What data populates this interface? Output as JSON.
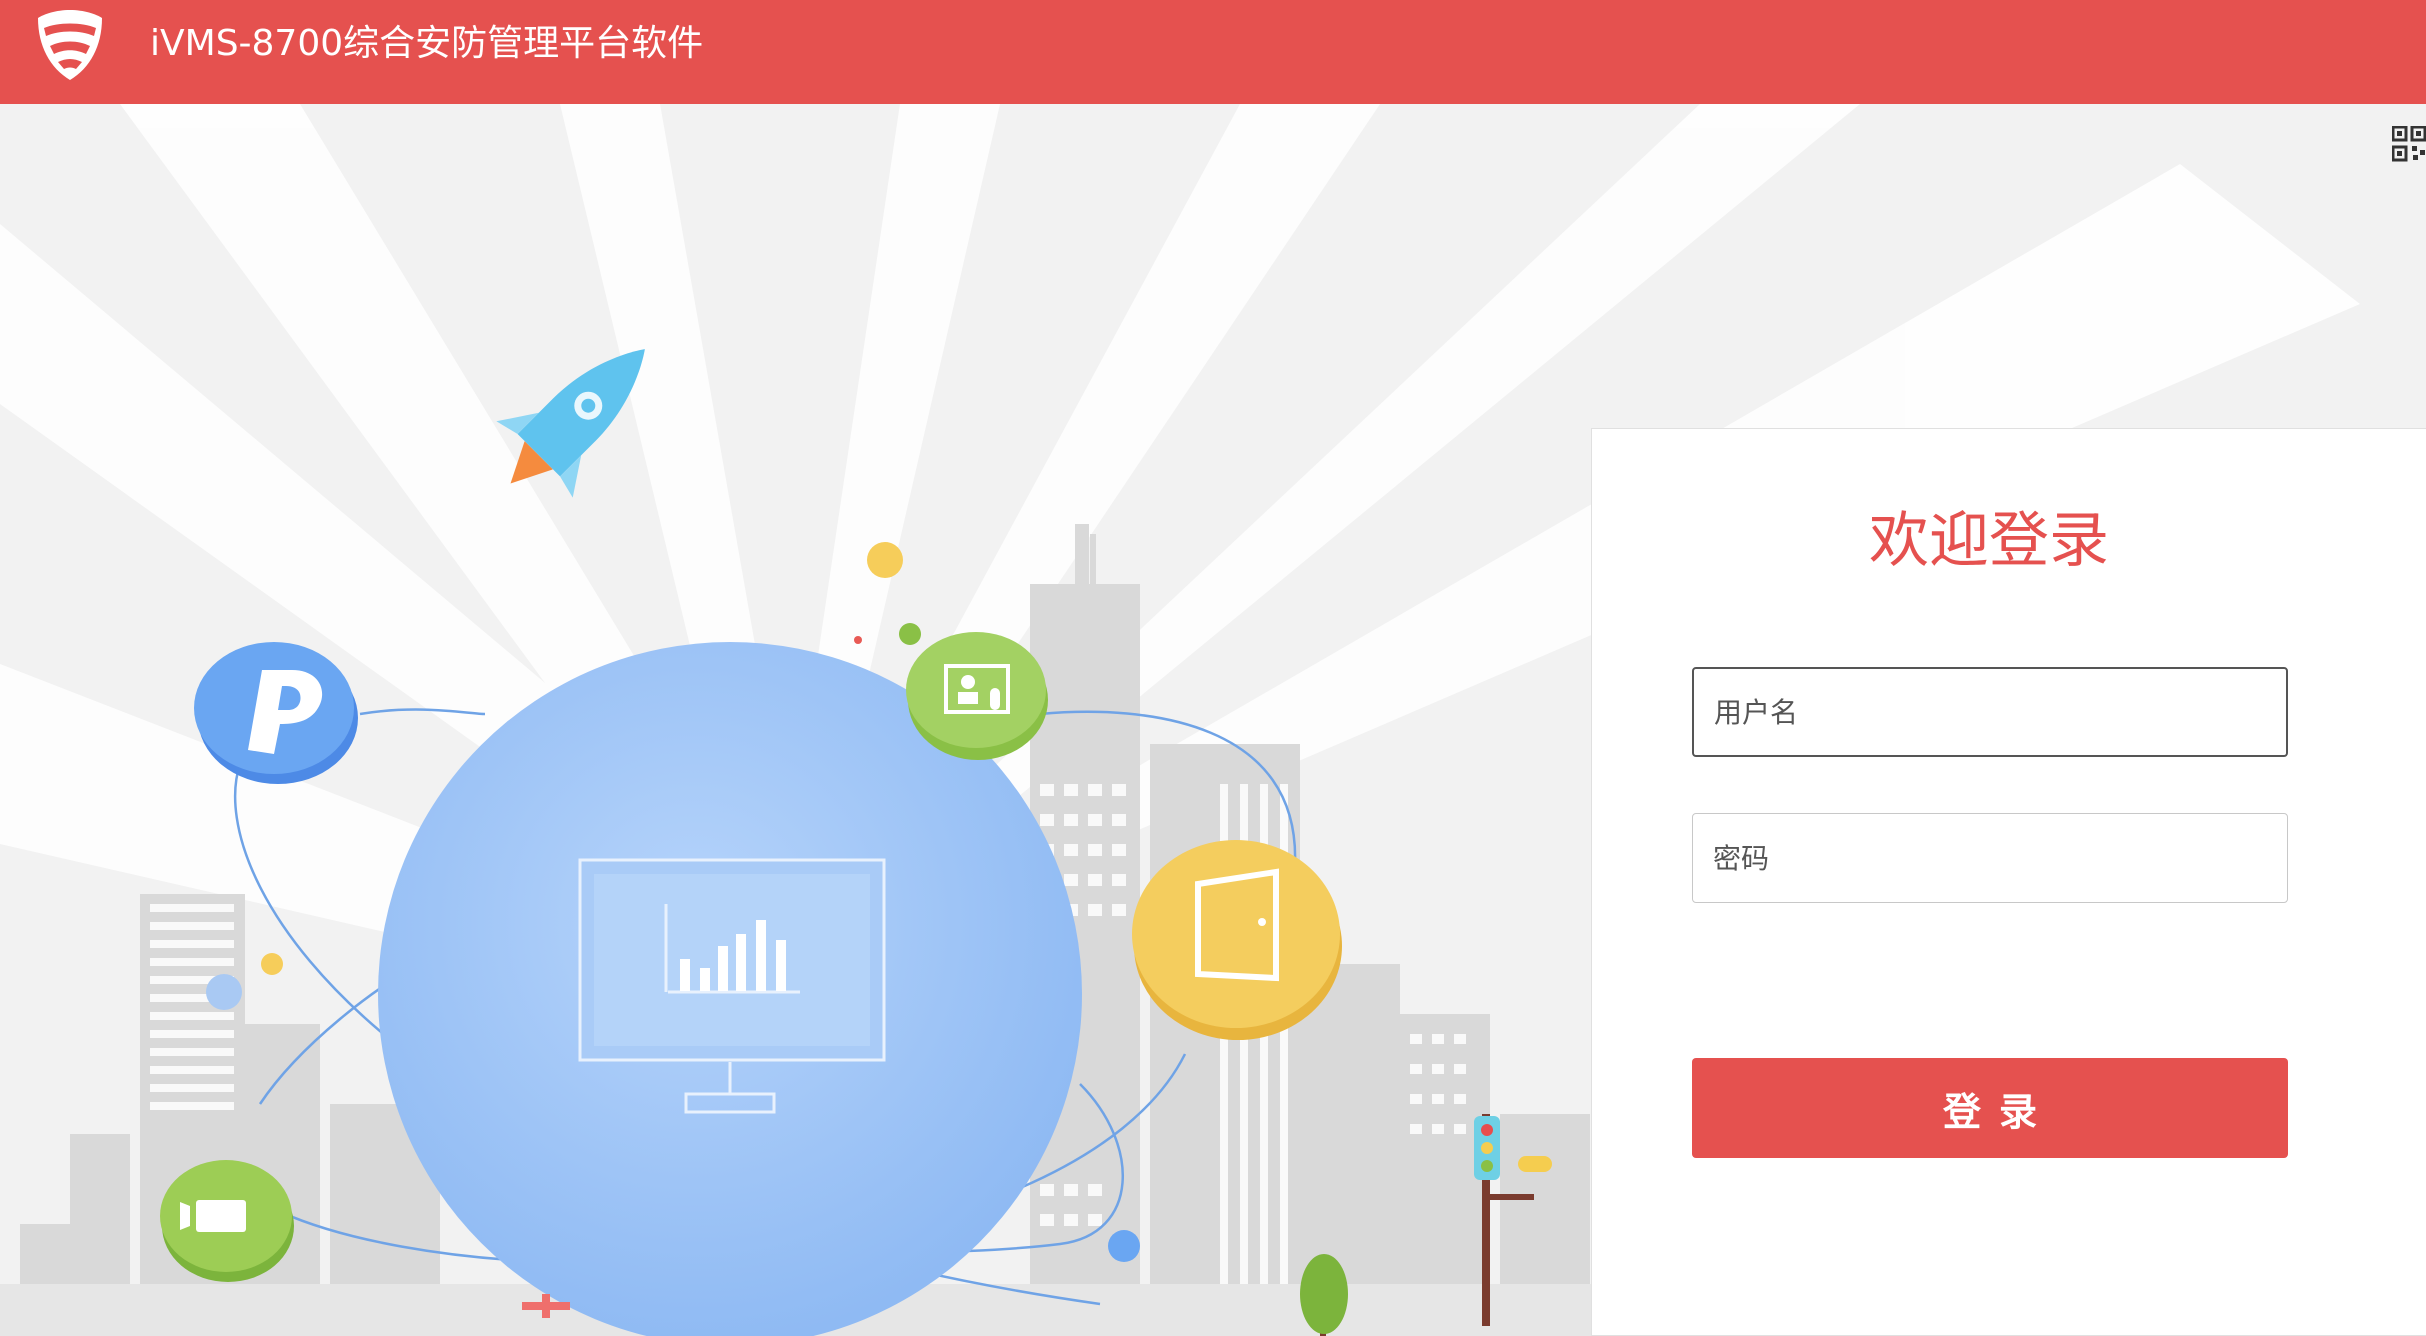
{
  "header": {
    "app_title": "iVMS-8700综合安防管理平台软件",
    "bg_color": "#e5514f"
  },
  "icons": {
    "logo": "shield-logo",
    "qr": "qr-code-icon",
    "parking": "parking-icon",
    "video_intercom": "video-intercom-icon",
    "door": "door-icon",
    "camera": "video-camera-icon",
    "monitor_chart": "monitor-chart-icon",
    "rocket": "rocket-icon",
    "traffic_light": "traffic-light-icon",
    "tree": "tree-icon"
  },
  "login": {
    "welcome": "欢迎登录",
    "username_placeholder": "用户名",
    "password_placeholder": "密码",
    "submit_label": "登录",
    "accent_color": "#e5514f"
  }
}
